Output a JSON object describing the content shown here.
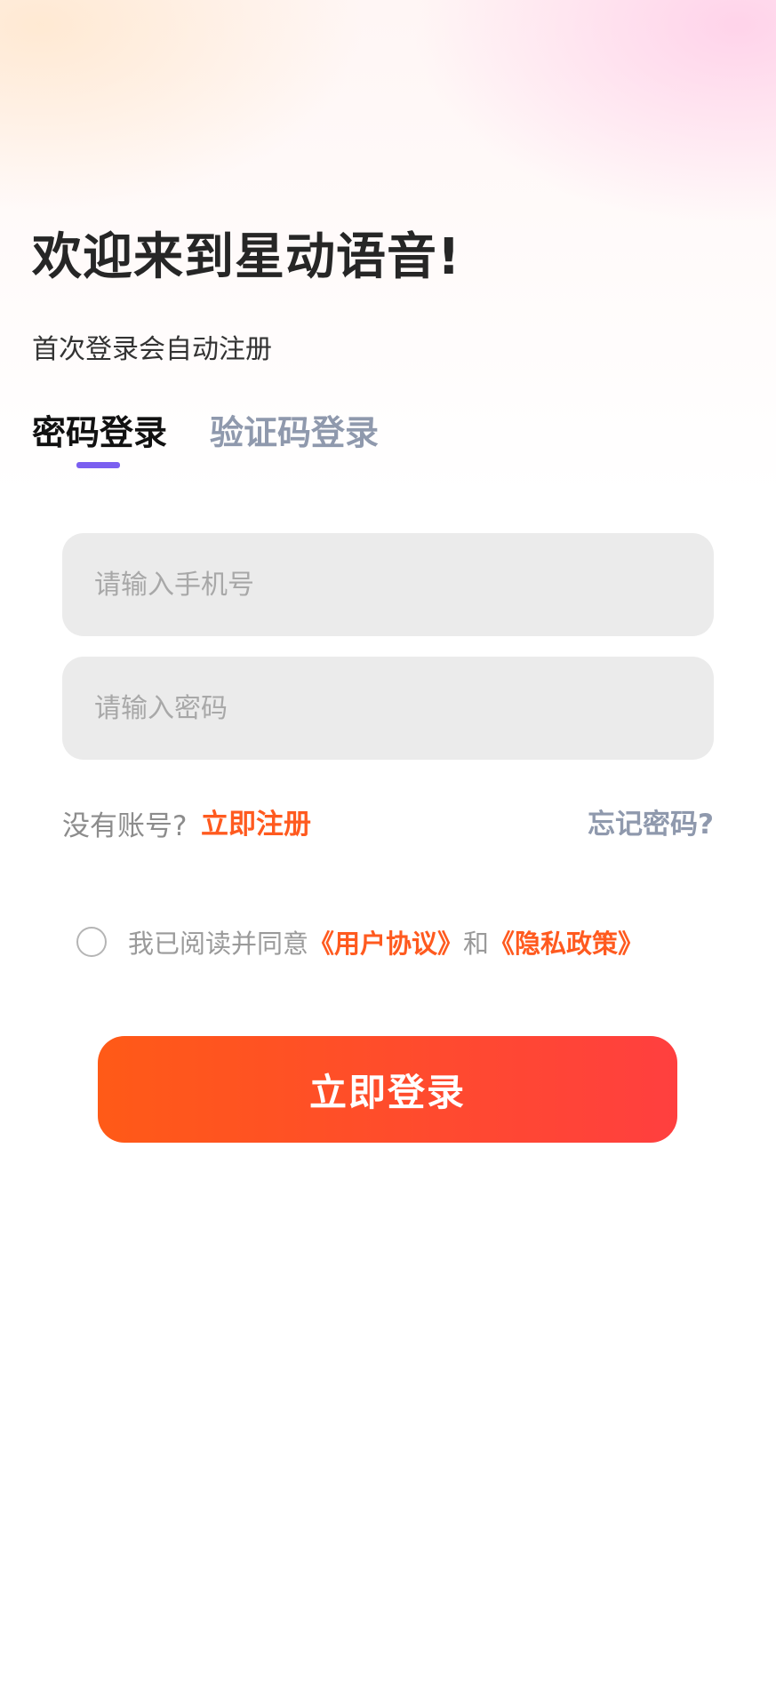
{
  "header": {
    "welcome_title": "欢迎来到星动语音!",
    "subtitle": "首次登录会自动注册"
  },
  "tabs": {
    "password_login": "密码登录",
    "sms_login": "验证码登录",
    "active": "密码登录"
  },
  "form": {
    "phone_placeholder": "请输入手机号",
    "phone_value": "",
    "password_placeholder": "请输入密码",
    "password_value": ""
  },
  "links": {
    "no_account": "没有账号?",
    "register": "立即注册",
    "forgot_password": "忘记密码?"
  },
  "agreement": {
    "checked": false,
    "prefix": "我已阅读并同意",
    "user_agreement": "《用户协议》",
    "conjunction": "和",
    "privacy_policy": "《隐私政策》"
  },
  "login_button": "立即登录",
  "colors": {
    "accent": "#ff5a1f",
    "tab_indicator": "#7b5ff0",
    "inactive_tab": "#8f99ad",
    "field_background": "#ebebeb"
  }
}
